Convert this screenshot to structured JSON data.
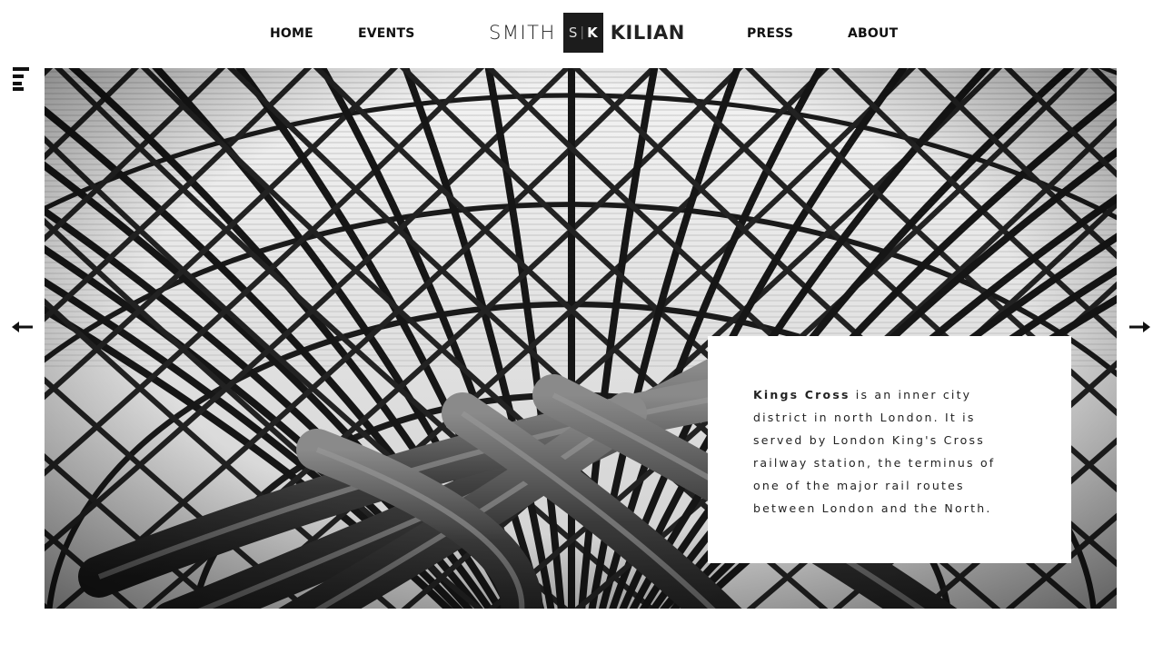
{
  "nav": {
    "home": "HOME",
    "events": "EVENTS",
    "press": "PRESS",
    "about": "ABOUT"
  },
  "logo": {
    "left": "SMITH",
    "mark_s": "S",
    "mark_k": "K",
    "right": "KILIAN"
  },
  "slide": {
    "caption_title": "Kings Cross",
    "caption_body": " is an inner city district in north London. It is served by London King's Cross railway station, the terminus of one of the major rail routes between London and the North."
  },
  "icons": {
    "menu": "hamburger-menu-icon",
    "prev": "arrow-left-icon",
    "next": "arrow-right-icon"
  },
  "colors": {
    "background": "#ffffff",
    "text": "#111111",
    "logo_box": "#1c1c1c"
  }
}
